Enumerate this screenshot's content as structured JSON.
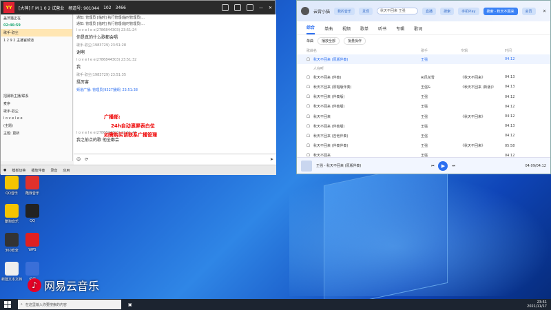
{
  "chat": {
    "logo": "YY",
    "title": "[大神] F M 1 0 2 试营业",
    "room": "频道号: 901044",
    "counts": [
      "102",
      "3466"
    ],
    "side": {
      "header": "盖茨猫正在",
      "time": "02:46:59",
      "items": [
        "歌手-驭尘",
        "1 2 9 2 主播官频道",
        "招募新主播/联系",
        "麦序",
        "歌手-驭尘",
        "l o v e l e e",
        "(主题)",
        "主题: 更新"
      ]
    },
    "system_lines": [
      "通知: 管理员 [临时] 执行管理(临时管理员)...",
      "通知: 管理员 [临时] 执行管理(临时管理员)..."
    ],
    "messages": [
      {
        "name": "l o v e l e e(2786844303)",
        "time": "23:51:24",
        "text": "你是真的什么歌都会唱"
      },
      {
        "name": "歌手-驭尘(1983729)",
        "time": "23:51:28",
        "text": "谢啊"
      },
      {
        "name": "l o v e l e e(2786844303)",
        "time": "23:51:32",
        "text": "我"
      },
      {
        "name": "歌手-驭尘(1983729)",
        "time": "23:51:35",
        "text": "挺厉害"
      },
      {
        "name": "频道广播: 管理员(9327播频)",
        "time": "23:51:38",
        "text": ""
      },
      {
        "name": "l o v e l e e(2786844303)",
        "time": "23:51:46",
        "text": "我之前点的歌  他全都会"
      }
    ],
    "ad": {
      "title": "广播部:",
      "line1": "24h自动滚屏表白位",
      "line2": "如需购买请联系广播管理"
    },
    "input_icon": "emoji-icon",
    "bottom": [
      "模板切换",
      "播放伴奏",
      "录音",
      "应用"
    ]
  },
  "music": {
    "user": "云霄小猫",
    "tabs": [
      "我的音乐",
      "发现",
      "直播",
      "搜索",
      "手机Play",
      "搜索 - 秋天不回来",
      "会员",
      "评论",
      "精彩评"
    ],
    "search_text": "秋天不回来 王强",
    "category_tabs": [
      "综合",
      "单曲",
      "视频",
      "歌单",
      "听书",
      "专辑",
      "歌词"
    ],
    "filters": [
      "单曲",
      "播放全部",
      "批量操作"
    ],
    "headers": [
      "歌曲名",
      "歌手",
      "专辑",
      "时间"
    ],
    "sub_row": "人在听",
    "rows": [
      {
        "title": "秋天不回来 (原版伴奏)",
        "singer": "王强",
        "album": "",
        "time": "04:12"
      },
      {
        "title": "秋天不回来 (伴奏)",
        "singer": "AI风花雪",
        "album": "《秋天不回来》",
        "time": "04:13"
      },
      {
        "title": "秋天不回来 (原唱版伴奏)",
        "singer": "王强&",
        "album": "《秋天不回来 (新版)》",
        "time": "04:13"
      },
      {
        "title": "秋天不回来 (伴奏版)",
        "singer": "王强",
        "album": "",
        "time": "04:12"
      },
      {
        "title": "秋天不回来 (伴奏版)",
        "singer": "王强",
        "album": "",
        "time": "04:12"
      },
      {
        "title": "秋天不回来",
        "singer": "王强",
        "album": "《秋天不回来》",
        "time": "04:12"
      },
      {
        "title": "秋天不回来 (伴奏版)",
        "singer": "王强",
        "album": "",
        "time": "04:13"
      },
      {
        "title": "秋天不回来 (吉他伴奏)",
        "singer": "王强",
        "album": "",
        "time": "04:12"
      },
      {
        "title": "秋天不回来 (伴奏伴奏)",
        "singer": "王强",
        "album": "《秋天不回来》",
        "time": "05:58"
      },
      {
        "title": "秋天不回来",
        "singer": "王强",
        "album": "",
        "time": "04:12"
      },
      {
        "title": "秋天不回来 (原版伴奏)",
        "singer": "王强",
        "album": "《秋天不回来》",
        "time": "04:13"
      }
    ],
    "player": {
      "song": "王强 - 秋天不回来 (原版伴奏)",
      "time": "04:09/04:12"
    }
  },
  "desktop": {
    "icons": [
      {
        "label": "QQ音乐",
        "color": "#f5c400"
      },
      {
        "label": "酷我音乐",
        "color": "#e0312b"
      },
      {
        "label": "酷狗音乐",
        "color": "#f5c400"
      },
      {
        "label": "QQ",
        "color": "#222222"
      },
      {
        "label": "360安全",
        "color": "#333333"
      },
      {
        "label": "WPS",
        "color": "#e02020"
      },
      {
        "label": "新建文本文档",
        "color": "#eeeeee"
      },
      {
        "label": "设置",
        "color": "#3a6fd8"
      }
    ],
    "netease": "网易云音乐"
  },
  "taskbar": {
    "search_placeholder": "在这里输入你要搜索的内容",
    "time": "23:51",
    "date": "2021/11/17"
  },
  "colors": {
    "accent": "#2d6ff0",
    "ad_red": "#e00000"
  }
}
